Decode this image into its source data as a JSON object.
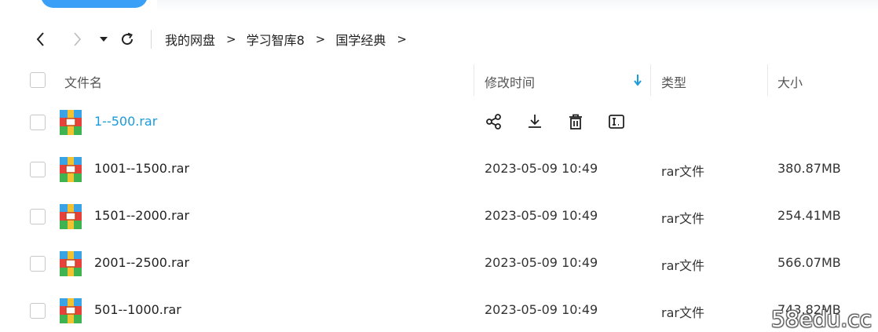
{
  "nav": {
    "back_icon": "chevron-left-icon",
    "forward_icon": "chevron-right-icon",
    "dropdown_icon": "caret-down-icon",
    "refresh_icon": "refresh-icon",
    "breadcrumb": [
      "我的网盘",
      "学习智库8",
      "国学经典"
    ],
    "separator": ">"
  },
  "table": {
    "columns": {
      "name": "文件名",
      "modified": "修改时间",
      "type": "类型",
      "size": "大小"
    },
    "sort_icon": "arrow-down-icon",
    "accent_color": "#1a9bdc",
    "rows": [
      {
        "name": "1--500.rar",
        "modified": "",
        "type": "",
        "size": "",
        "hovered": true
      },
      {
        "name": "1001--1500.rar",
        "modified": "2023-05-09 10:49",
        "type": "rar文件",
        "size": "380.87MB"
      },
      {
        "name": "1501--2000.rar",
        "modified": "2023-05-09 10:49",
        "type": "rar文件",
        "size": "254.41MB"
      },
      {
        "name": "2001--2500.rar",
        "modified": "2023-05-09 10:49",
        "type": "rar文件",
        "size": "566.07MB"
      },
      {
        "name": "501--1000.rar",
        "modified": "2023-05-09 10:49",
        "type": "rar文件",
        "size": "743.82MB"
      }
    ],
    "row_actions": [
      "share-icon",
      "download-icon",
      "delete-icon",
      "rename-icon"
    ]
  },
  "watermark": "58edu.cc"
}
